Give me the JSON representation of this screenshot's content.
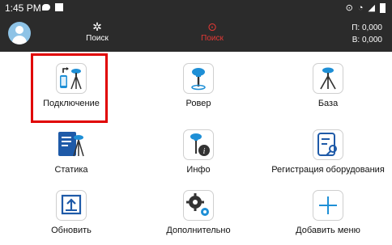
{
  "status_bar": {
    "time": "1:45 PM"
  },
  "toolbar": {
    "search_label": "Поиск",
    "status_label": "Поиск",
    "coord_p": "П: 0,000",
    "coord_v": "В: 0,000"
  },
  "menu": {
    "connect": "Подключение",
    "rover": "Ровер",
    "base": "База",
    "static": "Статика",
    "info": "Инфо",
    "register": "Регистрация оборудования",
    "update": "Обновить",
    "more": "Дополнительно",
    "add_menu": "Добавить меню"
  },
  "colors": {
    "bar": "#2b2b2b",
    "accent": "#1e8fd6",
    "alert": "#e53935",
    "highlight": "#e00000"
  }
}
